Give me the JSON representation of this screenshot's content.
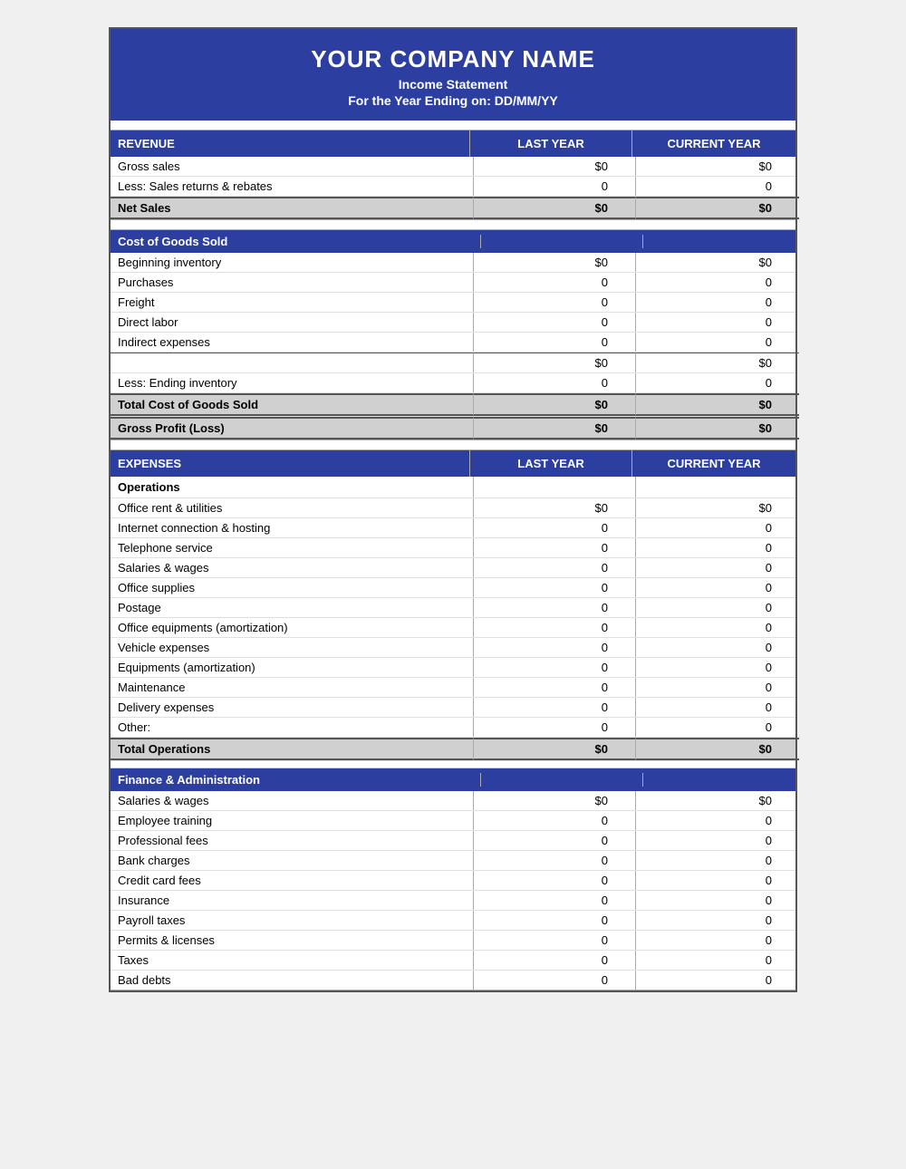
{
  "header": {
    "company_name": "YOUR COMPANY NAME",
    "title": "Income Statement",
    "date_line": "For the Year Ending on: DD/MM/YY"
  },
  "revenue_section": {
    "header_label": "REVENUE",
    "col1": "LAST YEAR",
    "col2": "CURRENT YEAR",
    "rows": [
      {
        "label": "Gross sales",
        "last_year": "$0",
        "current_year": "$0"
      },
      {
        "label": "Less: Sales returns & rebates",
        "last_year": "0",
        "current_year": "0"
      }
    ],
    "total_row": {
      "label": "Net Sales",
      "last_year": "$0",
      "current_year": "$0"
    }
  },
  "cogs_section": {
    "header_label": "Cost of Goods Sold",
    "rows": [
      {
        "label": "Beginning inventory",
        "last_year": "$0",
        "current_year": "$0"
      },
      {
        "label": "Purchases",
        "last_year": "0",
        "current_year": "0"
      },
      {
        "label": "Freight",
        "last_year": "0",
        "current_year": "0"
      },
      {
        "label": "Direct labor",
        "last_year": "0",
        "current_year": "0"
      },
      {
        "label": "Indirect expenses",
        "last_year": "0",
        "current_year": "0"
      }
    ],
    "subtotal_row": {
      "label": "",
      "last_year": "$0",
      "current_year": "$0"
    },
    "ending_inventory_row": {
      "label": "Less: Ending inventory",
      "last_year": "0",
      "current_year": "0"
    },
    "total_cogs_row": {
      "label": "Total Cost of Goods Sold",
      "last_year": "$0",
      "current_year": "$0"
    },
    "gross_profit_row": {
      "label": "Gross Profit (Loss)",
      "last_year": "$0",
      "current_year": "$0"
    }
  },
  "expenses_section": {
    "header_label": "EXPENSES",
    "col1": "LAST YEAR",
    "col2": "CURRENT YEAR",
    "operations": {
      "header": "Operations",
      "rows": [
        {
          "label": "Office rent & utilities",
          "last_year": "$0",
          "current_year": "$0"
        },
        {
          "label": "Internet connection & hosting",
          "last_year": "0",
          "current_year": "0"
        },
        {
          "label": "Telephone service",
          "last_year": "0",
          "current_year": "0"
        },
        {
          "label": "Salaries & wages",
          "last_year": "0",
          "current_year": "0"
        },
        {
          "label": "Office supplies",
          "last_year": "0",
          "current_year": "0"
        },
        {
          "label": "Postage",
          "last_year": "0",
          "current_year": "0"
        },
        {
          "label": "Office equipments (amortization)",
          "last_year": "0",
          "current_year": "0"
        },
        {
          "label": "Vehicle expenses",
          "last_year": "0",
          "current_year": "0"
        },
        {
          "label": "Equipments (amortization)",
          "last_year": "0",
          "current_year": "0"
        },
        {
          "label": "Maintenance",
          "last_year": "0",
          "current_year": "0"
        },
        {
          "label": "Delivery expenses",
          "last_year": "0",
          "current_year": "0"
        },
        {
          "label": "Other:",
          "last_year": "0",
          "current_year": "0"
        }
      ],
      "total_row": {
        "label": "Total Operations",
        "last_year": "$0",
        "current_year": "$0"
      }
    },
    "finance": {
      "header": "Finance & Administration",
      "rows": [
        {
          "label": "Salaries & wages",
          "last_year": "$0",
          "current_year": "$0"
        },
        {
          "label": "Employee training",
          "last_year": "0",
          "current_year": "0"
        },
        {
          "label": "Professional fees",
          "last_year": "0",
          "current_year": "0"
        },
        {
          "label": "Bank charges",
          "last_year": "0",
          "current_year": "0"
        },
        {
          "label": "Credit card fees",
          "last_year": "0",
          "current_year": "0"
        },
        {
          "label": "Insurance",
          "last_year": "0",
          "current_year": "0"
        },
        {
          "label": "Payroll taxes",
          "last_year": "0",
          "current_year": "0"
        },
        {
          "label": "Permits & licenses",
          "last_year": "0",
          "current_year": "0"
        },
        {
          "label": "Taxes",
          "last_year": "0",
          "current_year": "0"
        },
        {
          "label": "Bad debts",
          "last_year": "0",
          "current_year": "0"
        }
      ]
    }
  }
}
